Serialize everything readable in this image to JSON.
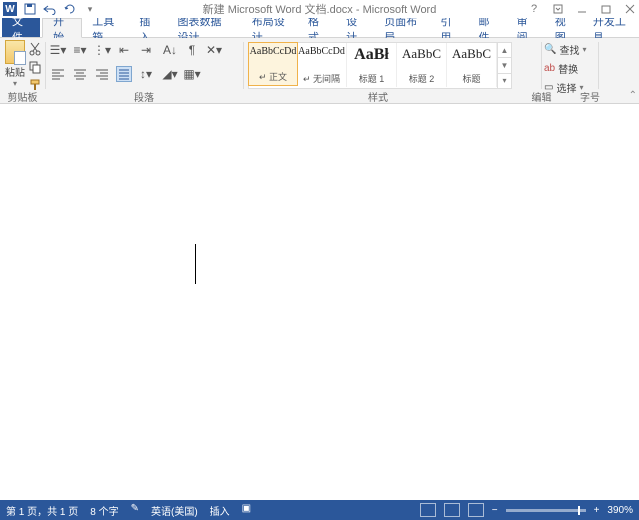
{
  "title": "新建 Microsoft Word 文档.docx - Microsoft Word",
  "menu": {
    "file": "文件",
    "tabs": [
      "开始",
      "工具箱",
      "插入",
      "图表数据设计",
      "布局设计",
      "格式",
      "设计",
      "页面布局",
      "引用",
      "邮件",
      "审阅",
      "视图",
      "开发工具"
    ]
  },
  "clipboard": {
    "paste": "粘贴",
    "group": "剪贴板"
  },
  "paragraph_group": "段落",
  "styles": {
    "group": "样式",
    "items": [
      {
        "preview": "AaBbCcDd",
        "name": "↵ 正文",
        "size": "10px"
      },
      {
        "preview": "AaBbCcDd",
        "name": "↵ 无间隔",
        "size": "10px"
      },
      {
        "preview": "AaBł",
        "name": "标题 1",
        "size": "16px"
      },
      {
        "preview": "AaBbC",
        "name": "标题 2",
        "size": "13px"
      },
      {
        "preview": "AaBbC",
        "name": "标题",
        "size": "13px"
      }
    ]
  },
  "editing": {
    "group": "编辑",
    "find": "查找",
    "replace": "替换",
    "select": "选择"
  },
  "font_size_group": "字号",
  "status": {
    "page": "第 1 页，共 1 页",
    "words": "8 个字",
    "lang": "英语(美国)",
    "insert": "插入",
    "zoom": "390%"
  }
}
